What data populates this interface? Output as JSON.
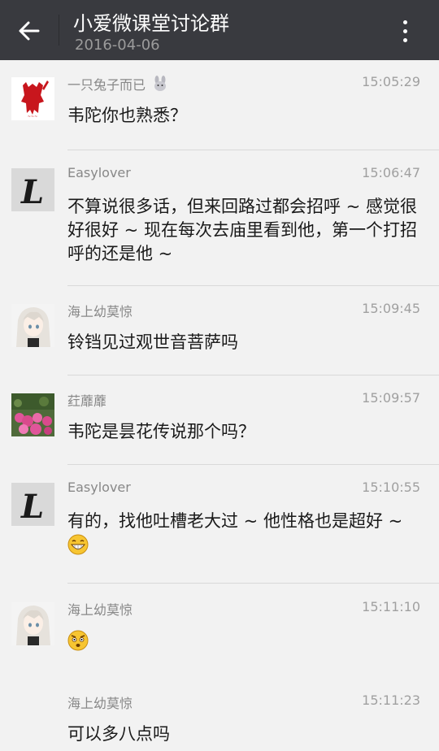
{
  "header": {
    "title": "小爱微课堂讨论群",
    "date": "2016-04-06"
  },
  "messages": [
    {
      "name": "一只兔子而已",
      "time": "15:05:29",
      "text": "韦陀你也熟悉？",
      "avatar": "red-devil-avatar",
      "name_icon": "bunny-icon"
    },
    {
      "name": "Easylover",
      "time": "15:06:47",
      "text": "不算说很多话，但来回路过都会招呼 ~ 感觉很好很好 ~ 现在每次去庙里看到他，第一个打招呼的还是他 ~",
      "avatar": "letter-l-avatar"
    },
    {
      "name": "海上幼莫惊",
      "time": "15:09:45",
      "text": "铃铛见过观世音菩萨吗",
      "avatar": "anime-girl-avatar"
    },
    {
      "name": "荭蘼蘼",
      "time": "15:09:57",
      "text": "韦陀是昙花传说那个吗？",
      "avatar": "flowers-avatar"
    },
    {
      "name": "Easylover",
      "time": "15:10:55",
      "text": "有的，找他吐槽老大过 ~ 他性格也是超好 ~",
      "avatar": "letter-l-avatar",
      "emoji": "grin-emoji"
    },
    {
      "name": "海上幼莫惊",
      "time": "15:11:10",
      "text": "",
      "avatar": "anime-girl-avatar",
      "emoji": "surprised-emoji"
    },
    {
      "name": "海上幼莫惊",
      "time": "15:11:23",
      "text": "可以多八点吗",
      "avatar": ""
    }
  ],
  "colors": {
    "topbar": "#393a3f",
    "background": "#f2f2f2"
  }
}
